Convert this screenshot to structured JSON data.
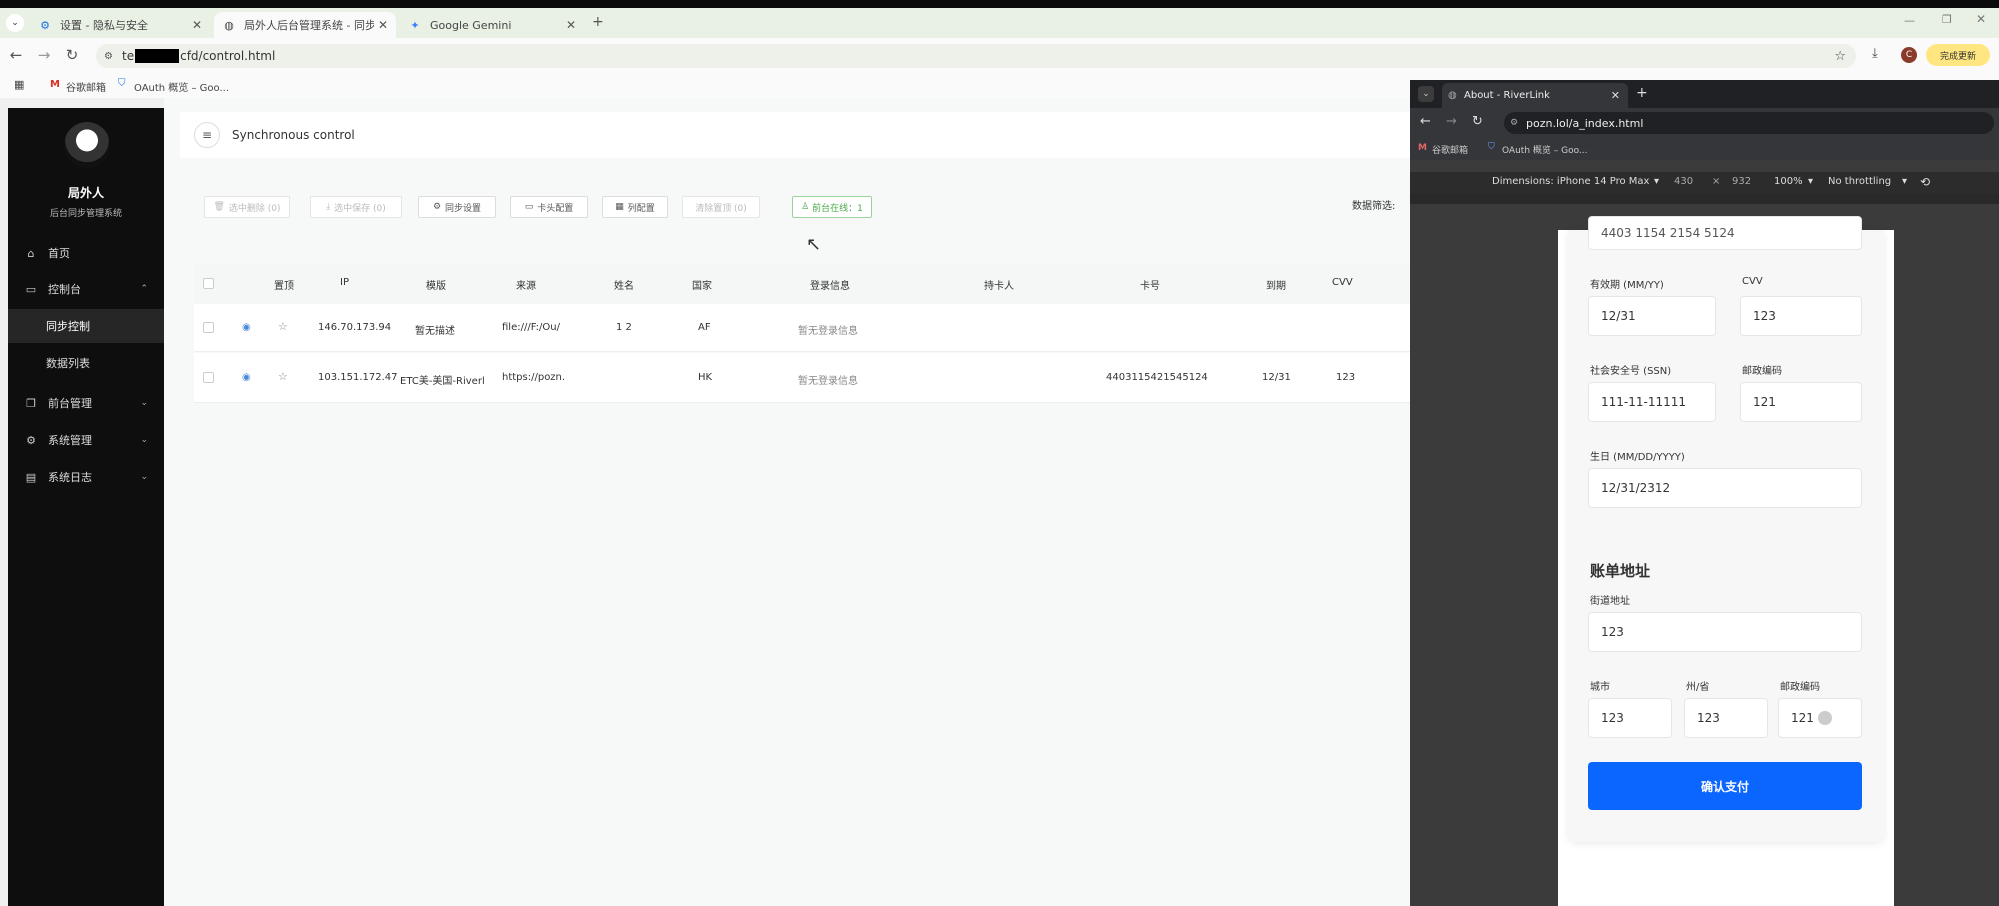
{
  "browser": {
    "tabs": [
      {
        "title": "设置 - 隐私与安全"
      },
      {
        "title": "局外人后台管理系统 - 同步控制"
      },
      {
        "title": "Google Gemini"
      }
    ],
    "url_prefix": "te",
    "url_suffix": "cfd/control.html",
    "update_button": "完成更新",
    "bookmarks": [
      "谷歌邮箱",
      "OAuth 概览 – Goo..."
    ]
  },
  "sidebar": {
    "brand": "局外人",
    "subtitle": "后台同步管理系统",
    "items": [
      {
        "label": "首页"
      },
      {
        "label": "控制台"
      },
      {
        "label": "同步控制"
      },
      {
        "label": "数据列表"
      },
      {
        "label": "前台管理"
      },
      {
        "label": "系统管理"
      },
      {
        "label": "系统日志"
      }
    ]
  },
  "header": {
    "title": "Synchronous control"
  },
  "toolbar": {
    "delete": "选中删除 (0)",
    "save": "选中保存 (0)",
    "sync": "同步设置",
    "card": "卡头配置",
    "columns": "列配置",
    "clear": "清除置顶 (0)",
    "online": "前台在线：1",
    "filter": "数据筛选:"
  },
  "table": {
    "headers": [
      "置顶",
      "IP",
      "模版",
      "来源",
      "姓名",
      "国家",
      "登录信息",
      "持卡人",
      "卡号",
      "到期",
      "CVV"
    ],
    "rows": [
      {
        "ip": "146.70.173.94",
        "template": "暂无描述",
        "source": "file:///F:/Ou/",
        "name": "1 2",
        "country": "AF",
        "login": "暂无登录信息",
        "holder": "",
        "card": "",
        "exp": "",
        "cvv": ""
      },
      {
        "ip": "103.151.172.47",
        "template": "ETC美-美国-Riverl",
        "source": "https://pozn.",
        "name": "",
        "country": "HK",
        "login": "暂无登录信息",
        "holder": "",
        "card": "4403115421545124",
        "exp": "12/31",
        "cvv": "123"
      }
    ]
  },
  "devtools": {
    "tab_title": "About - RiverLink",
    "url": "pozn.lol/a_index.html",
    "bookmarks": [
      "谷歌邮箱",
      "OAuth 概览 – Goo..."
    ],
    "device": "Dimensions: iPhone 14 Pro Max",
    "width": "430",
    "height": "932",
    "zoom": "100%",
    "throttle": "No throttling"
  },
  "form": {
    "card_number_partial": "4403 1154 2154 5124",
    "expiry_label": "有效期 (MM/YY)",
    "expiry": "12/31",
    "cvv_label": "CVV",
    "cvv": "123",
    "ssn_label": "社会安全号 (SSN)",
    "ssn": "111-11-11111",
    "zip_label": "邮政编码",
    "zip": "121",
    "dob_label": "生日 (MM/DD/YYYY)",
    "dob": "12/31/2312",
    "billing_title": "账单地址",
    "street_label": "街道地址",
    "street": "123",
    "city_label": "城市",
    "city": "123",
    "state_label": "州/省",
    "state": "123",
    "zip2_label": "邮政编码",
    "zip2": "121",
    "pay_button": "确认支付"
  },
  "colors": {
    "accent": "#0a66ff",
    "online": "#4aa94a",
    "sidebar": "#0e0e0e"
  }
}
